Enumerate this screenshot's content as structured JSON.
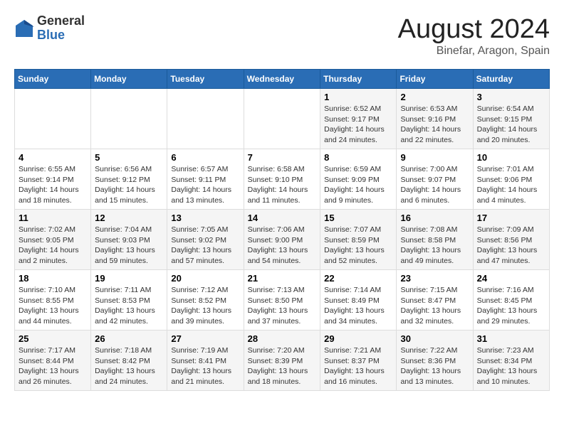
{
  "logo": {
    "general": "General",
    "blue": "Blue"
  },
  "title": "August 2024",
  "location": "Binefar, Aragon, Spain",
  "days_header": [
    "Sunday",
    "Monday",
    "Tuesday",
    "Wednesday",
    "Thursday",
    "Friday",
    "Saturday"
  ],
  "weeks": [
    [
      {
        "num": "",
        "detail": ""
      },
      {
        "num": "",
        "detail": ""
      },
      {
        "num": "",
        "detail": ""
      },
      {
        "num": "",
        "detail": ""
      },
      {
        "num": "1",
        "detail": "Sunrise: 6:52 AM\nSunset: 9:17 PM\nDaylight: 14 hours\nand 24 minutes."
      },
      {
        "num": "2",
        "detail": "Sunrise: 6:53 AM\nSunset: 9:16 PM\nDaylight: 14 hours\nand 22 minutes."
      },
      {
        "num": "3",
        "detail": "Sunrise: 6:54 AM\nSunset: 9:15 PM\nDaylight: 14 hours\nand 20 minutes."
      }
    ],
    [
      {
        "num": "4",
        "detail": "Sunrise: 6:55 AM\nSunset: 9:14 PM\nDaylight: 14 hours\nand 18 minutes."
      },
      {
        "num": "5",
        "detail": "Sunrise: 6:56 AM\nSunset: 9:12 PM\nDaylight: 14 hours\nand 15 minutes."
      },
      {
        "num": "6",
        "detail": "Sunrise: 6:57 AM\nSunset: 9:11 PM\nDaylight: 14 hours\nand 13 minutes."
      },
      {
        "num": "7",
        "detail": "Sunrise: 6:58 AM\nSunset: 9:10 PM\nDaylight: 14 hours\nand 11 minutes."
      },
      {
        "num": "8",
        "detail": "Sunrise: 6:59 AM\nSunset: 9:09 PM\nDaylight: 14 hours\nand 9 minutes."
      },
      {
        "num": "9",
        "detail": "Sunrise: 7:00 AM\nSunset: 9:07 PM\nDaylight: 14 hours\nand 6 minutes."
      },
      {
        "num": "10",
        "detail": "Sunrise: 7:01 AM\nSunset: 9:06 PM\nDaylight: 14 hours\nand 4 minutes."
      }
    ],
    [
      {
        "num": "11",
        "detail": "Sunrise: 7:02 AM\nSunset: 9:05 PM\nDaylight: 14 hours\nand 2 minutes."
      },
      {
        "num": "12",
        "detail": "Sunrise: 7:04 AM\nSunset: 9:03 PM\nDaylight: 13 hours\nand 59 minutes."
      },
      {
        "num": "13",
        "detail": "Sunrise: 7:05 AM\nSunset: 9:02 PM\nDaylight: 13 hours\nand 57 minutes."
      },
      {
        "num": "14",
        "detail": "Sunrise: 7:06 AM\nSunset: 9:00 PM\nDaylight: 13 hours\nand 54 minutes."
      },
      {
        "num": "15",
        "detail": "Sunrise: 7:07 AM\nSunset: 8:59 PM\nDaylight: 13 hours\nand 52 minutes."
      },
      {
        "num": "16",
        "detail": "Sunrise: 7:08 AM\nSunset: 8:58 PM\nDaylight: 13 hours\nand 49 minutes."
      },
      {
        "num": "17",
        "detail": "Sunrise: 7:09 AM\nSunset: 8:56 PM\nDaylight: 13 hours\nand 47 minutes."
      }
    ],
    [
      {
        "num": "18",
        "detail": "Sunrise: 7:10 AM\nSunset: 8:55 PM\nDaylight: 13 hours\nand 44 minutes."
      },
      {
        "num": "19",
        "detail": "Sunrise: 7:11 AM\nSunset: 8:53 PM\nDaylight: 13 hours\nand 42 minutes."
      },
      {
        "num": "20",
        "detail": "Sunrise: 7:12 AM\nSunset: 8:52 PM\nDaylight: 13 hours\nand 39 minutes."
      },
      {
        "num": "21",
        "detail": "Sunrise: 7:13 AM\nSunset: 8:50 PM\nDaylight: 13 hours\nand 37 minutes."
      },
      {
        "num": "22",
        "detail": "Sunrise: 7:14 AM\nSunset: 8:49 PM\nDaylight: 13 hours\nand 34 minutes."
      },
      {
        "num": "23",
        "detail": "Sunrise: 7:15 AM\nSunset: 8:47 PM\nDaylight: 13 hours\nand 32 minutes."
      },
      {
        "num": "24",
        "detail": "Sunrise: 7:16 AM\nSunset: 8:45 PM\nDaylight: 13 hours\nand 29 minutes."
      }
    ],
    [
      {
        "num": "25",
        "detail": "Sunrise: 7:17 AM\nSunset: 8:44 PM\nDaylight: 13 hours\nand 26 minutes."
      },
      {
        "num": "26",
        "detail": "Sunrise: 7:18 AM\nSunset: 8:42 PM\nDaylight: 13 hours\nand 24 minutes."
      },
      {
        "num": "27",
        "detail": "Sunrise: 7:19 AM\nSunset: 8:41 PM\nDaylight: 13 hours\nand 21 minutes."
      },
      {
        "num": "28",
        "detail": "Sunrise: 7:20 AM\nSunset: 8:39 PM\nDaylight: 13 hours\nand 18 minutes."
      },
      {
        "num": "29",
        "detail": "Sunrise: 7:21 AM\nSunset: 8:37 PM\nDaylight: 13 hours\nand 16 minutes."
      },
      {
        "num": "30",
        "detail": "Sunrise: 7:22 AM\nSunset: 8:36 PM\nDaylight: 13 hours\nand 13 minutes."
      },
      {
        "num": "31",
        "detail": "Sunrise: 7:23 AM\nSunset: 8:34 PM\nDaylight: 13 hours\nand 10 minutes."
      }
    ]
  ]
}
